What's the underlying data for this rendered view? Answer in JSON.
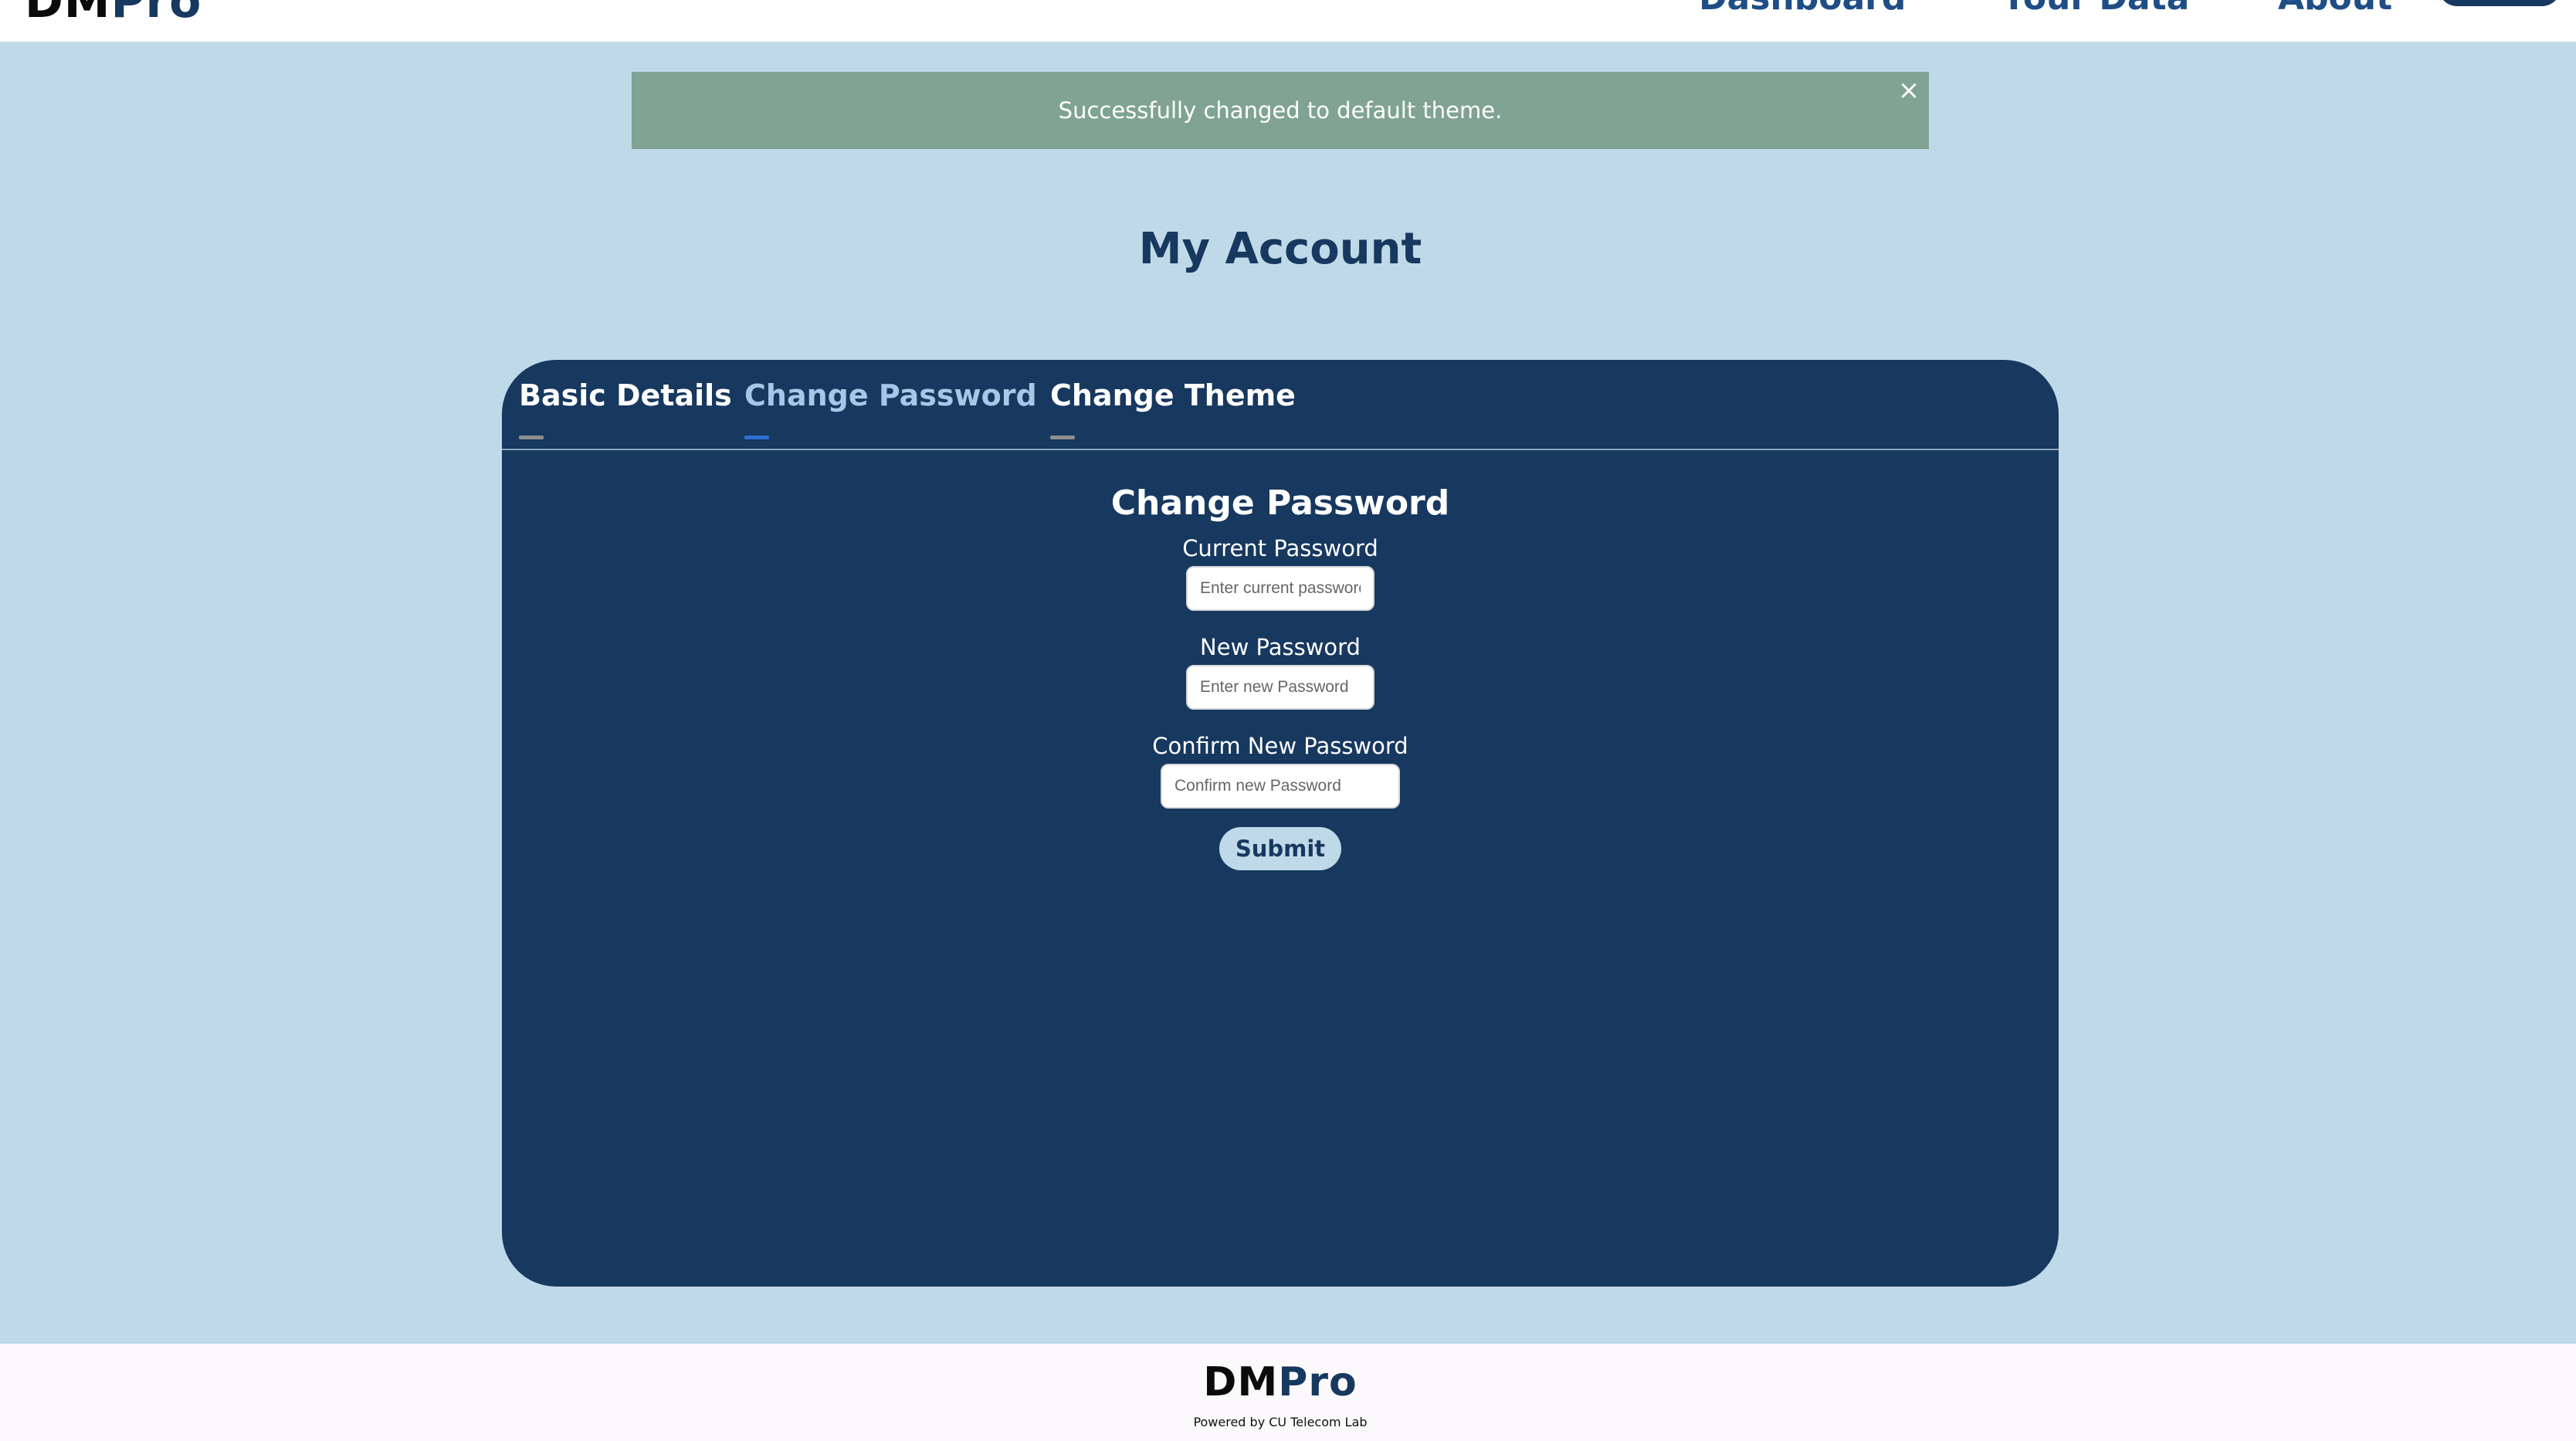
{
  "nav": {
    "brand_dm": "DM",
    "brand_pro": "Pro",
    "links": [
      "Dashboard",
      "Your Data",
      "About"
    ]
  },
  "alert": {
    "message": "Successfully changed to default theme.",
    "close_icon": "×"
  },
  "page_title": "My Account",
  "tabs": [
    {
      "label": "Basic Details",
      "active": false
    },
    {
      "label": "Change Password",
      "active": true
    },
    {
      "label": "Change Theme",
      "active": false
    }
  ],
  "form": {
    "heading": "Change Password",
    "current": {
      "label": "Current Password",
      "placeholder": "Enter current password"
    },
    "new": {
      "label": "New Password",
      "placeholder": "Enter new Password"
    },
    "confirm": {
      "label": "Confirm New Password",
      "placeholder": "Confirm new Password"
    },
    "submit_label": "Submit"
  },
  "footer": {
    "brand_dm": "DM",
    "brand_pro": "Pro",
    "powered_by": "Powered by CU Telecom Lab"
  },
  "colors": {
    "background": "#c0d9e8",
    "navy": "#17385f",
    "alert": "#80a393",
    "active_tab": "#a8c6e6",
    "active_underline": "#2e6fd1"
  }
}
